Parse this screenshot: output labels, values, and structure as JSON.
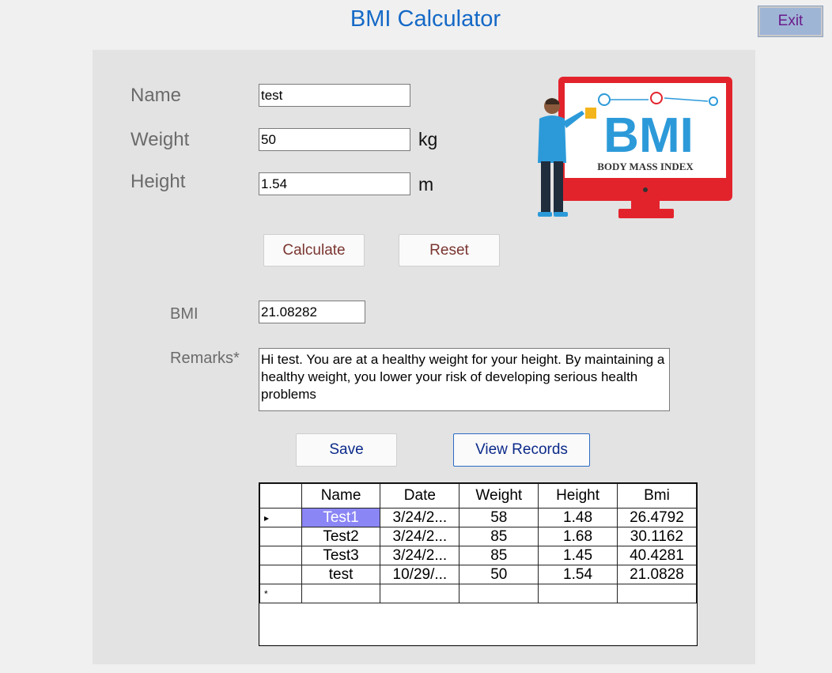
{
  "app": {
    "title": "BMI Calculator",
    "exit_label": "Exit"
  },
  "form": {
    "name_label": "Name",
    "name_value": "test",
    "weight_label": "Weight",
    "weight_value": "50",
    "weight_unit": "kg",
    "height_label": "Height",
    "height_value": "1.54",
    "height_unit": "m"
  },
  "buttons": {
    "calculate": "Calculate",
    "reset": "Reset",
    "save": "Save",
    "view_records": "View Records"
  },
  "result": {
    "bmi_label": "BMI",
    "bmi_value": "21.08282",
    "remarks_label": "Remarks*",
    "remarks_text": "Hi test. You are at a healthy weight for your height. By maintaining a healthy weight, you lower your risk of developing serious health problems"
  },
  "logo": {
    "text": "BMI",
    "caption": "BODY MASS INDEX"
  },
  "records": {
    "columns": [
      "Name",
      "Date",
      "Weight",
      "Height",
      "Bmi"
    ],
    "rows": [
      [
        "Test1",
        "3/24/2...",
        "58",
        "1.48",
        "26.4792"
      ],
      [
        "Test2",
        "3/24/2...",
        "85",
        "1.68",
        "30.1162"
      ],
      [
        "Test3",
        "3/24/2...",
        "85",
        "1.45",
        "40.4281"
      ],
      [
        "test",
        "10/29/...",
        "50",
        "1.54",
        "21.0828"
      ]
    ],
    "current_marker": "▸",
    "new_row_marker": "*"
  },
  "colors": {
    "title": "#1569c7",
    "selected_cell": "#8b86f5",
    "logo_red": "#e3232c",
    "logo_blue": "#2c9ad9",
    "logo_yellow": "#f3b51b"
  }
}
